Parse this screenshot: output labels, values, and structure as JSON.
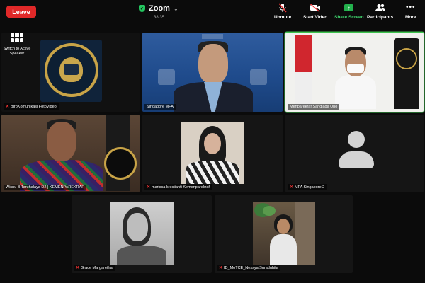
{
  "top_bar": {
    "leave_label": "Leave",
    "title": "Zoom",
    "timer": "38:35",
    "controls": [
      {
        "label": "Unmute",
        "icon": "mic-muted-icon"
      },
      {
        "label": "Start Video",
        "icon": "video-off-icon"
      },
      {
        "label": "Share Screen",
        "icon": "share-screen-icon"
      },
      {
        "label": "Participants",
        "icon": "participants-icon"
      },
      {
        "label": "More",
        "icon": "more-icon"
      }
    ]
  },
  "switch_speaker": {
    "label": "Switch to Active Speaker",
    "icon": "grid-view-icon"
  },
  "tiles": [
    {
      "name": "BiroKomunikasi FotoVideo",
      "muted": true
    },
    {
      "name": "Singapore MFA",
      "muted": false,
      "active": false
    },
    {
      "name": "Menparekraf Sandiaga Uno",
      "muted": false,
      "active": true
    },
    {
      "name": "Wisnu B Taruhalaya D2 | KEMENPAREKRAF",
      "muted": false
    },
    {
      "name": "marissa krestianti Kemenparekraf",
      "muted": true
    },
    {
      "name": "MFA Singapore 2",
      "muted": true
    },
    {
      "name": "Grace Margaretha",
      "muted": true
    },
    {
      "name": "ID_MoTCE_Nessya Suraduhita",
      "muted": true
    }
  ],
  "colors": {
    "leave": "#e02828",
    "active_border": "#3ec24e",
    "share": "#23b14d",
    "mute": "#e33333"
  }
}
